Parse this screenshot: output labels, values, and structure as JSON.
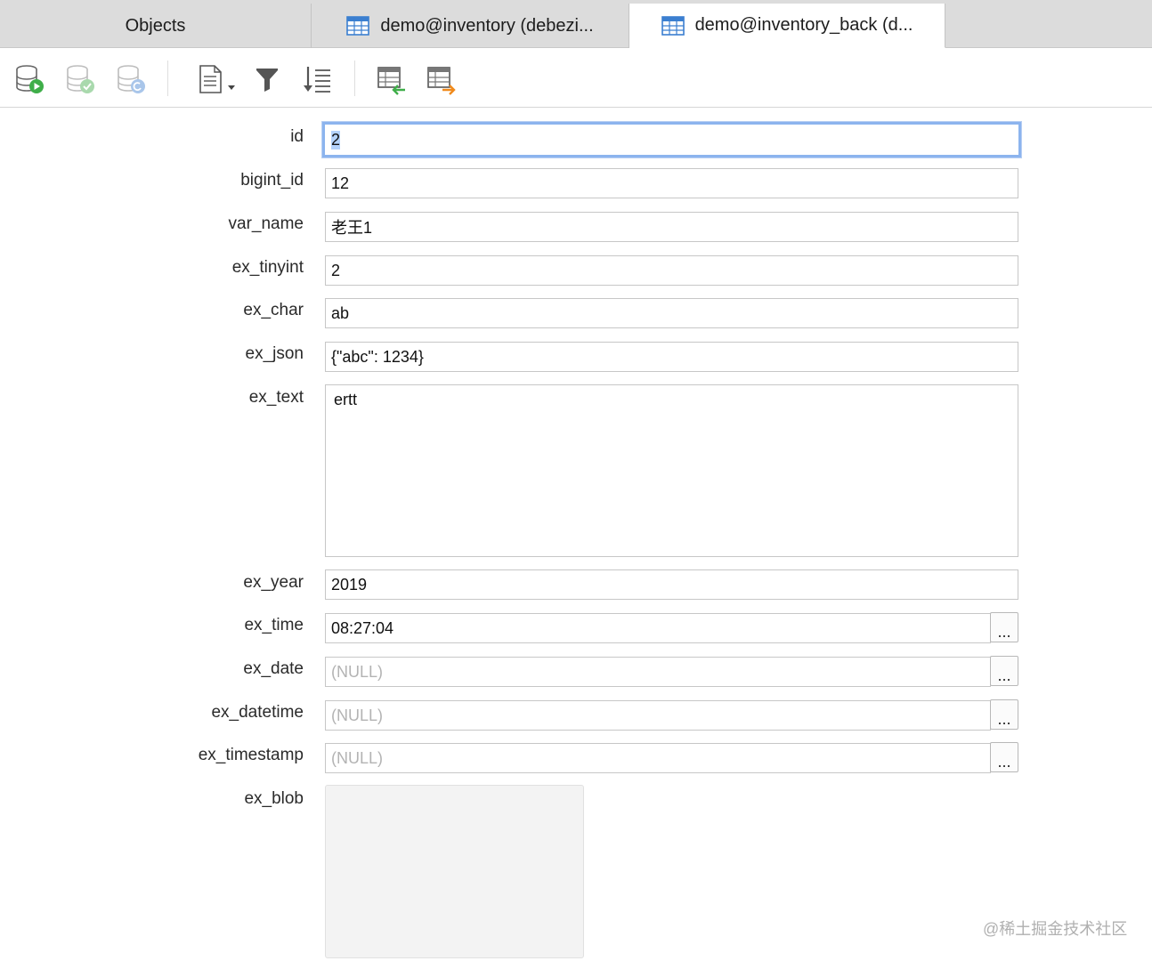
{
  "tabs": [
    {
      "label": "Objects",
      "icon": "none",
      "active": false
    },
    {
      "label": "demo@inventory (debezi...",
      "icon": "table-grid-icon",
      "active": false
    },
    {
      "label": "demo@inventory_back (d...",
      "icon": "table-grid-icon",
      "active": true
    }
  ],
  "toolbar": {
    "buttons": [
      {
        "name": "begin-transaction",
        "icon": "database-play-icon",
        "enabled": true
      },
      {
        "name": "commit",
        "icon": "database-check-icon",
        "enabled": false
      },
      {
        "name": "rollback",
        "icon": "database-undo-icon",
        "enabled": false
      },
      {
        "name": "text-view",
        "icon": "document-dropdown-icon",
        "enabled": true
      },
      {
        "name": "filter",
        "icon": "filter-icon",
        "enabled": true
      },
      {
        "name": "sort",
        "icon": "sort-icon",
        "enabled": true
      },
      {
        "name": "import",
        "icon": "table-import-icon",
        "enabled": true
      },
      {
        "name": "export",
        "icon": "table-export-icon",
        "enabled": true
      }
    ]
  },
  "form": {
    "fields": [
      {
        "label": "id",
        "value": "2"
      },
      {
        "label": "bigint_id",
        "value": "12"
      },
      {
        "label": "var_name",
        "value": "老王1"
      },
      {
        "label": "ex_tinyint",
        "value": "2"
      },
      {
        "label": "ex_char",
        "value": "ab"
      },
      {
        "label": "ex_json",
        "value": "{\"abc\": 1234}"
      },
      {
        "label": "ex_text",
        "value": "ertt"
      },
      {
        "label": "ex_year",
        "value": "2019"
      },
      {
        "label": "ex_time",
        "value": "08:27:04"
      },
      {
        "label": "ex_date",
        "value": "(NULL)"
      },
      {
        "label": "ex_datetime",
        "value": "(NULL)"
      },
      {
        "label": "ex_timestamp",
        "value": "(NULL)"
      },
      {
        "label": "ex_blob",
        "value": ""
      }
    ],
    "picker_label": "..."
  },
  "watermark": "@稀土掘金技术社区",
  "colors": {
    "focus_border": "#8cb4ee",
    "selection": "#b4d2fb",
    "null_text": "#b3b3b3",
    "tabbar_bg": "#dcdcdc"
  }
}
